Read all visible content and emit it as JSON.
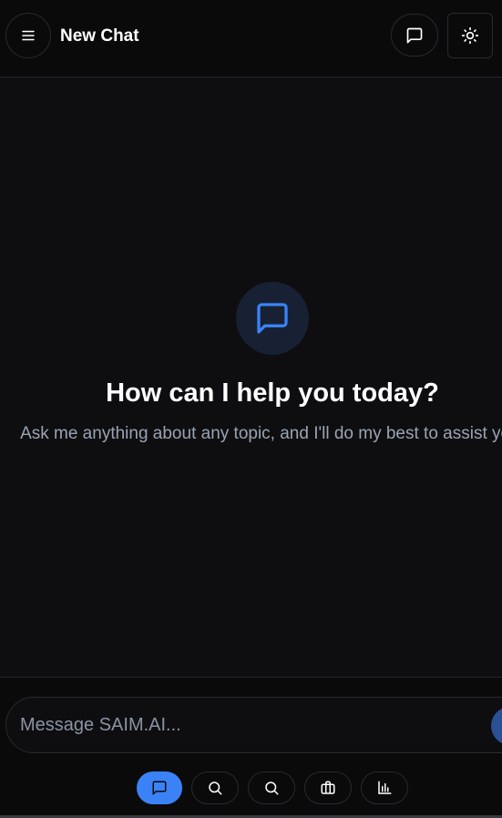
{
  "header": {
    "title": "New Chat",
    "menu_icon": "menu-icon",
    "new_chat_icon": "message-square-icon",
    "theme_icon": "sun-icon"
  },
  "welcome": {
    "icon": "message-square-icon",
    "heading": "How can I help you today?",
    "subtitle": "Ask me anything about any topic, and I'll do my best to assist you."
  },
  "composer": {
    "placeholder": "Message SAIM.AI...",
    "value": "",
    "modes": [
      {
        "icon": "message-square-icon",
        "active": true
      },
      {
        "icon": "search-icon",
        "active": false
      },
      {
        "icon": "search-icon",
        "active": false
      },
      {
        "icon": "briefcase-icon",
        "active": false
      },
      {
        "icon": "bar-chart-icon",
        "active": false
      }
    ]
  },
  "colors": {
    "background": "#0e0e11",
    "header": "#0a0a0b",
    "accent": "#3b82f6",
    "icon_bubble": "#172133",
    "muted_text": "#9aa4b2"
  }
}
